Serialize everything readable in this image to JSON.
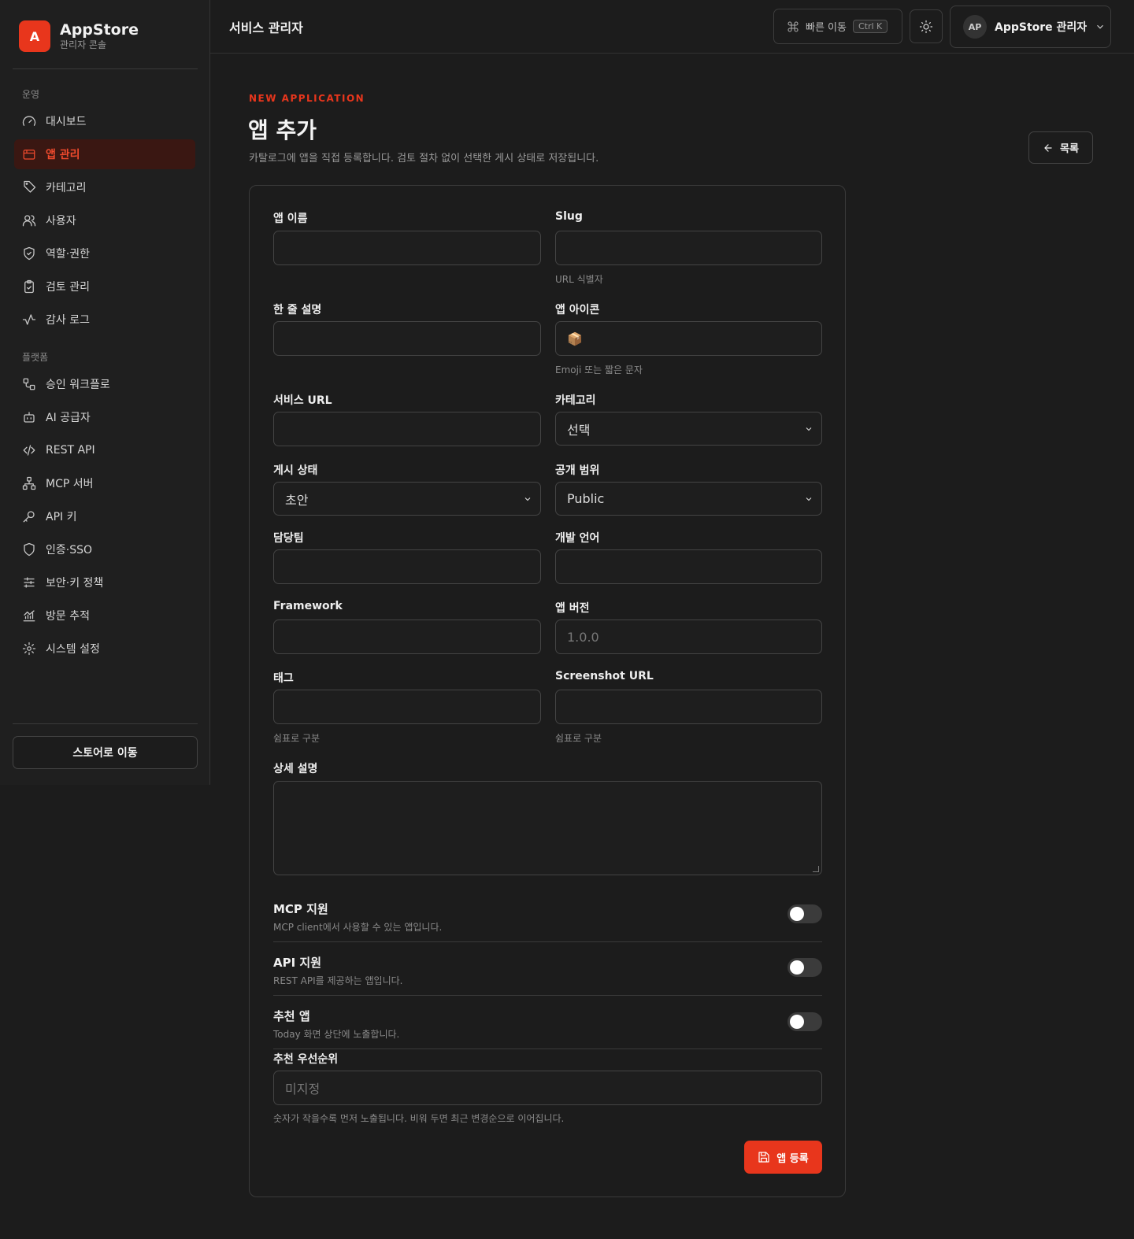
{
  "brand": {
    "logo_letter": "A",
    "name": "AppStore",
    "subtitle": "관리자 콘솔"
  },
  "sidebar": {
    "section_ops": "운영",
    "ops_items": [
      {
        "label": "대시보드",
        "icon": "gauge-icon"
      },
      {
        "label": "앱 관리",
        "icon": "app-window-icon",
        "active": true
      },
      {
        "label": "카테고리",
        "icon": "tag-icon"
      },
      {
        "label": "사용자",
        "icon": "users-icon"
      },
      {
        "label": "역할·권한",
        "icon": "shield-check-icon"
      },
      {
        "label": "검토 관리",
        "icon": "clipboard-check-icon"
      },
      {
        "label": "감사 로그",
        "icon": "activity-icon"
      }
    ],
    "section_platform": "플랫폼",
    "platform_items": [
      {
        "label": "승인 워크플로",
        "icon": "workflow-icon"
      },
      {
        "label": "AI 공급자",
        "icon": "bot-icon"
      },
      {
        "label": "REST API",
        "icon": "code-icon"
      },
      {
        "label": "MCP 서버",
        "icon": "network-icon"
      },
      {
        "label": "API 키",
        "icon": "key-icon"
      },
      {
        "label": "인증·SSO",
        "icon": "shield-icon"
      },
      {
        "label": "보안·키 정책",
        "icon": "sliders-icon"
      },
      {
        "label": "방문 추적",
        "icon": "chart-icon"
      },
      {
        "label": "시스템 설정",
        "icon": "gear-icon"
      }
    ],
    "store_button": "스토어로 이동"
  },
  "header": {
    "title": "서비스 관리자",
    "quick_nav": "빠른 이동",
    "shortcut": "Ctrl K",
    "user_initials": "AP",
    "user_name": "AppStore 관리자"
  },
  "main": {
    "eyebrow": "NEW APPLICATION",
    "title": "앱 추가",
    "description": "카탈로그에 앱을 직접 등록합니다. 검토 절차 없이 선택한 게시 상태로 저장됩니다.",
    "back_button": "목록"
  },
  "form": {
    "app_name_label": "앱 이름",
    "app_name_value": "",
    "slug_label": "Slug",
    "slug_value": "",
    "slug_hint": "URL 식별자",
    "short_desc_label": "한 줄 설명",
    "short_desc_value": "",
    "icon_label": "앱 아이콘",
    "icon_value": "📦",
    "icon_hint": "Emoji 또는 짧은 문자",
    "service_url_label": "서비스 URL",
    "service_url_value": "",
    "category_label": "카테고리",
    "category_value": "선택",
    "status_label": "게시 상태",
    "status_value": "초안",
    "visibility_label": "공개 범위",
    "visibility_value": "Public",
    "team_label": "담당팀",
    "team_value": "",
    "language_label": "개발 언어",
    "language_value": "",
    "framework_label": "Framework",
    "framework_value": "",
    "version_label": "앱 버전",
    "version_placeholder": "1.0.0",
    "tags_label": "태그",
    "tags_value": "",
    "tags_hint": "쉼표로 구분",
    "screenshot_label": "Screenshot URL",
    "screenshot_value": "",
    "screenshot_hint": "쉼표로 구분",
    "detail_label": "상세 설명",
    "detail_value": "",
    "mcp_title": "MCP 지원",
    "mcp_desc": "MCP client에서 사용할 수 있는 앱입니다.",
    "mcp_on": false,
    "api_title": "API 지원",
    "api_desc": "REST API를 제공하는 앱입니다.",
    "api_on": false,
    "featured_title": "추천 앱",
    "featured_desc": "Today 화면 상단에 노출합니다.",
    "featured_on": false,
    "priority_label": "추천 우선순위",
    "priority_placeholder": "미지정",
    "priority_hint": "숫자가 작을수록 먼저 노출됩니다. 비워 두면 최근 변경순으로 이어집니다.",
    "submit_button": "앱 등록"
  },
  "colors": {
    "accent": "#e8361c",
    "background": "#1c1c1c",
    "sidebar": "#1f1f1f"
  }
}
